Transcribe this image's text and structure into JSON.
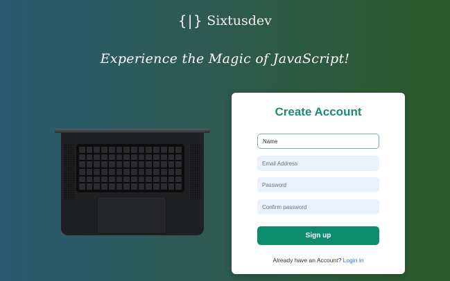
{
  "brand": {
    "logo": "{|}",
    "name": "Sixtusdev"
  },
  "hero": {
    "tagline": "Experience the Magic of JavaScript!"
  },
  "form": {
    "title": "Create Account",
    "name_placeholder": "Name",
    "email_placeholder": "Email Address",
    "password_placeholder": "Password",
    "confirm_placeholder": "Confirm password",
    "submit_label": "Sign up",
    "login_prompt": "Already have an Account?",
    "login_link": "Login in"
  },
  "colors": {
    "accent": "#0e8d6e",
    "title": "#1a8a72",
    "link": "#2a6fc9",
    "input_bg": "#e8f2fd"
  }
}
